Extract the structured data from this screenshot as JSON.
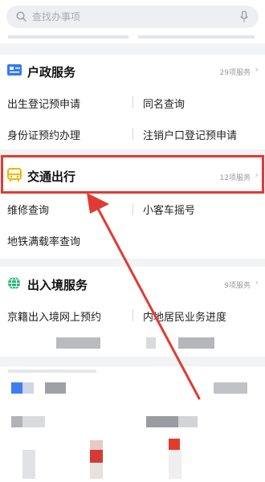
{
  "search": {
    "placeholder": "查找办事项"
  },
  "sections": {
    "household": {
      "title": "户政服务",
      "count": "29项服务",
      "items": [
        "出生登记预申请",
        "同名查询",
        "身份证预约办理",
        "注销户口登记预申请"
      ]
    },
    "transport": {
      "title": "交通出行",
      "count": "12项服务",
      "items": [
        "维修查询",
        "小客车摇号",
        "地铁满载率查询"
      ]
    },
    "entry_exit": {
      "title": "出入境服务",
      "count": "9项服务",
      "items": [
        "京籍出入境网上预约",
        "内地居民业务进度"
      ]
    }
  },
  "colors": {
    "accent_highlight": "#e03b33",
    "transport_icon": "#f5b300",
    "household_icon": "#2f7cf6",
    "entry_exit_icon": "#2bb673"
  },
  "icons": {
    "search": "search-icon",
    "mic": "mic-icon",
    "household": "id-card-icon",
    "transport": "bus-icon",
    "entry_exit": "globe-icon",
    "chevron": "chevron-right-icon"
  }
}
